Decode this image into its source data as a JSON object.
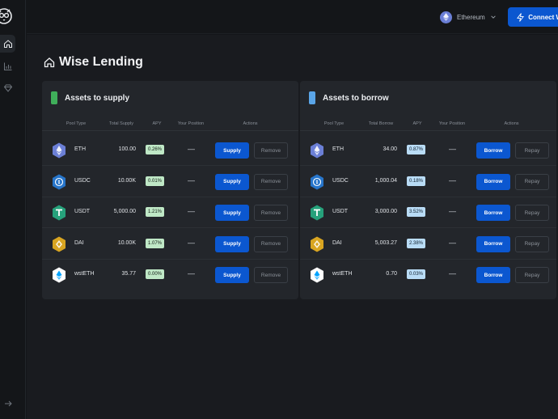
{
  "app": {
    "title": "Wise Lending"
  },
  "header": {
    "network_label": "Ethereum",
    "connect_label": "Connect Wallet"
  },
  "colors": {
    "accent": "#0b57d0",
    "supply_bar": "#3fae5a",
    "borrow_bar": "#5aa5e8",
    "apy_supply_bg": "#bfe8c6",
    "apy_borrow_bg": "#b9dcf6"
  },
  "supply": {
    "title": "Assets to supply",
    "columns": [
      "Pool Type",
      "Total Supply",
      "APY",
      "Your Position",
      "Actions"
    ],
    "action_primary": "Supply",
    "action_secondary": "Remove",
    "rows": [
      {
        "icon": "eth-icon",
        "name": "ETH",
        "total": "100.00",
        "apy": "0.26%",
        "position": "—"
      },
      {
        "icon": "usdc-icon",
        "name": "USDC",
        "total": "10.00K",
        "apy": "0.01%",
        "position": "—"
      },
      {
        "icon": "usdt-icon",
        "name": "USDT",
        "total": "5,000.00",
        "apy": "1.21%",
        "position": "—"
      },
      {
        "icon": "dai-icon",
        "name": "DAI",
        "total": "10.00K",
        "apy": "1.07%",
        "position": "—"
      },
      {
        "icon": "wsteth-icon",
        "name": "wstETH",
        "total": "35.77",
        "apy": "0.00%",
        "position": "—"
      }
    ]
  },
  "borrow": {
    "title": "Assets to borrow",
    "columns": [
      "Pool Type",
      "Total Borrow",
      "APY",
      "Your Position",
      "Actions"
    ],
    "action_primary": "Borrow",
    "action_secondary": "Repay",
    "rows": [
      {
        "icon": "eth-icon",
        "name": "ETH",
        "total": "34.00",
        "apy": "0.87%",
        "position": "—"
      },
      {
        "icon": "usdc-icon",
        "name": "USDC",
        "total": "1,000.04",
        "apy": "0.18%",
        "position": "—"
      },
      {
        "icon": "usdt-icon",
        "name": "USDT",
        "total": "3,000.00",
        "apy": "3.52%",
        "position": "—"
      },
      {
        "icon": "dai-icon",
        "name": "DAI",
        "total": "5,003.27",
        "apy": "2.38%",
        "position": "—"
      },
      {
        "icon": "wsteth-icon",
        "name": "wstETH",
        "total": "0.70",
        "apy": "0.03%",
        "position": "—"
      }
    ]
  }
}
